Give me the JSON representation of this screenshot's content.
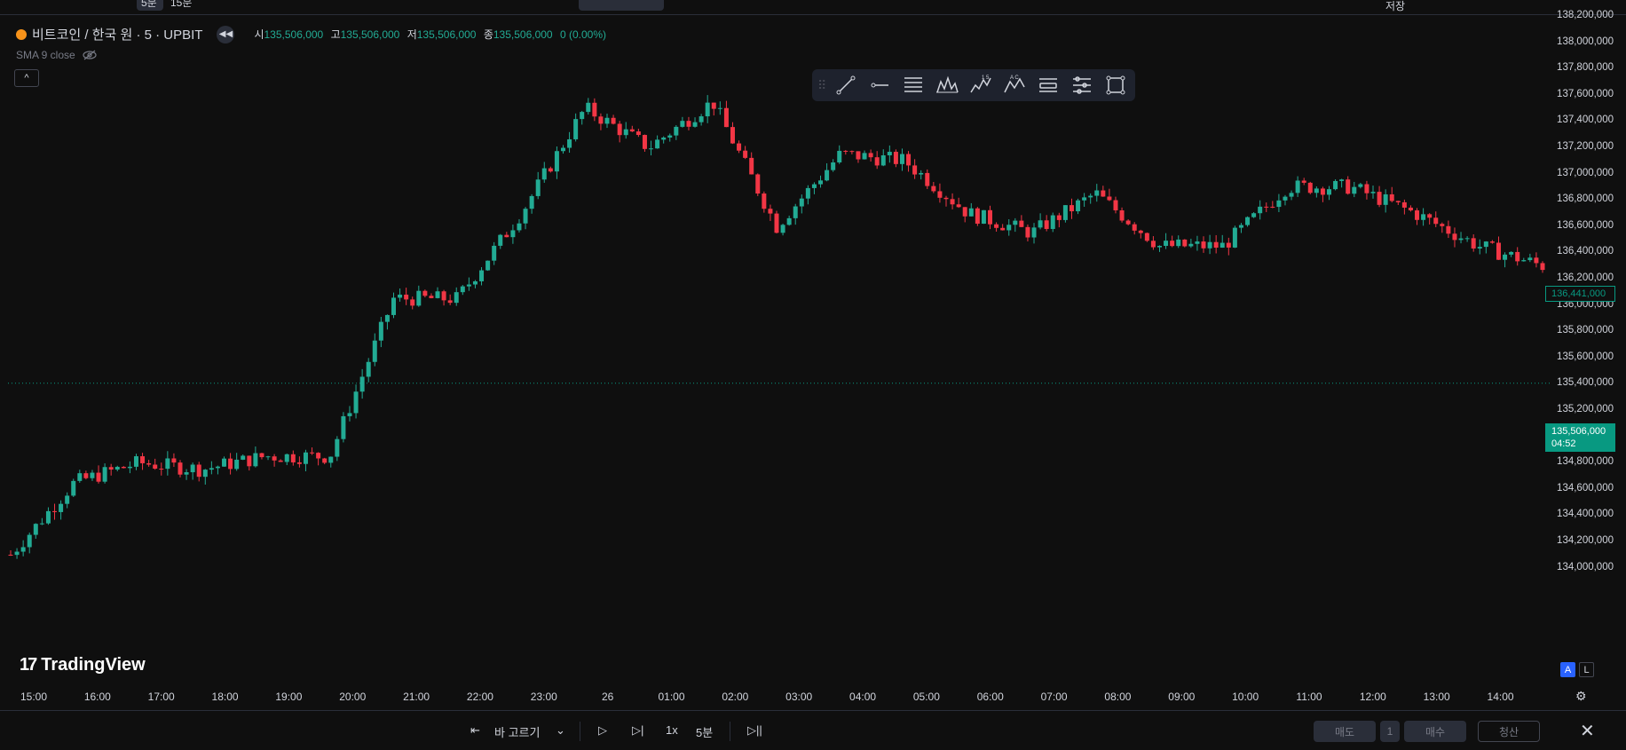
{
  "topbar": {
    "timeframe_1": "5분",
    "timeframe_2": "15분",
    "save_label": "저장"
  },
  "legend": {
    "symbol": "비트코인 / 한국 원 · 5 · UPBIT",
    "open_label": "시",
    "open": "135,506,000",
    "high_label": "고",
    "high": "135,506,000",
    "low_label": "저",
    "low": "135,506,000",
    "close_label": "종",
    "close": "135,506,000",
    "change": "0 (0.00%)",
    "sma": "SMA 9 close",
    "collapse": "^"
  },
  "price_axis": {
    "labels": [
      "138,200,000",
      "138,000,000",
      "137,800,000",
      "137,600,000",
      "137,400,000",
      "137,200,000",
      "137,000,000",
      "136,800,000",
      "136,600,000",
      "136,400,000",
      "136,200,000",
      "136,000,000",
      "135,800,000",
      "135,600,000",
      "135,400,000",
      "135,200,000",
      "135,000,000",
      "134,800,000",
      "134,600,000",
      "134,400,000",
      "134,200,000",
      "134,000,000"
    ],
    "current_price": "135,506,000",
    "countdown": "04:52",
    "sma_price": "136,441,000"
  },
  "time_axis": {
    "labels": [
      "15:00",
      "16:00",
      "17:00",
      "18:00",
      "19:00",
      "20:00",
      "21:00",
      "22:00",
      "23:00",
      "26",
      "01:00",
      "02:00",
      "03:00",
      "04:00",
      "05:00",
      "06:00",
      "07:00",
      "08:00",
      "09:00",
      "10:00",
      "11:00",
      "12:00",
      "13:00",
      "14:00"
    ]
  },
  "branding": {
    "logo_text": "TradingView"
  },
  "scale_buttons": {
    "auto": "A",
    "log": "L"
  },
  "bottom_bar": {
    "bar_replay": "바 고르기",
    "speed": "1x",
    "interval": "5분",
    "sell": "매도",
    "qty": "1",
    "buy": "매수",
    "settle": "청산"
  },
  "colors": {
    "up": "#22ab94",
    "down": "#f23645",
    "background": "#0f0f0f",
    "accent": "#2962ff"
  },
  "chart_data": {
    "type": "candlestick",
    "symbol": "비트코인 / 한국 원 · 5 · UPBIT",
    "xlabel": "",
    "ylabel": "",
    "ylim": [
      133900000,
      138300000
    ],
    "x": [
      "15:00",
      "16:00",
      "17:00",
      "18:00",
      "19:00",
      "20:00",
      "21:00",
      "22:00",
      "23:00",
      "26",
      "01:00",
      "02:00",
      "03:00",
      "04:00",
      "05:00",
      "06:00",
      "07:00",
      "08:00",
      "09:00",
      "10:00",
      "11:00",
      "12:00",
      "13:00",
      "14:00",
      "14:50"
    ],
    "close": [
      134200000,
      134750000,
      134900000,
      134850000,
      134950000,
      134950000,
      136150000,
      136150000,
      136800000,
      137600000,
      137300000,
      137650000,
      136700000,
      137250000,
      137200000,
      136800000,
      136650000,
      136950000,
      136550000,
      136550000,
      137000000,
      137000000,
      136800000,
      136550000,
      136400000
    ],
    "high": [
      134350000,
      134950000,
      135050000,
      135000000,
      135250000,
      135050000,
      136650000,
      136600000,
      137350000,
      137850000,
      137450000,
      137700000,
      137450000,
      137550000,
      137400000,
      137050000,
      136900000,
      137050000,
      136700000,
      136850000,
      137150000,
      137150000,
      137000000,
      136750000,
      136550000
    ],
    "low": [
      134150000,
      134300000,
      134750000,
      134750000,
      134850000,
      134850000,
      135050000,
      135700000,
      136000000,
      137000000,
      136900000,
      137150000,
      136500000,
      136900000,
      136900000,
      136700000,
      136500000,
      136700000,
      136400000,
      136400000,
      136600000,
      136650000,
      136750000,
      136450000,
      136300000
    ],
    "current_price": 135506000,
    "sma_value": 136441000,
    "legend": [
      "SMA 9 close"
    ],
    "grid": false
  }
}
